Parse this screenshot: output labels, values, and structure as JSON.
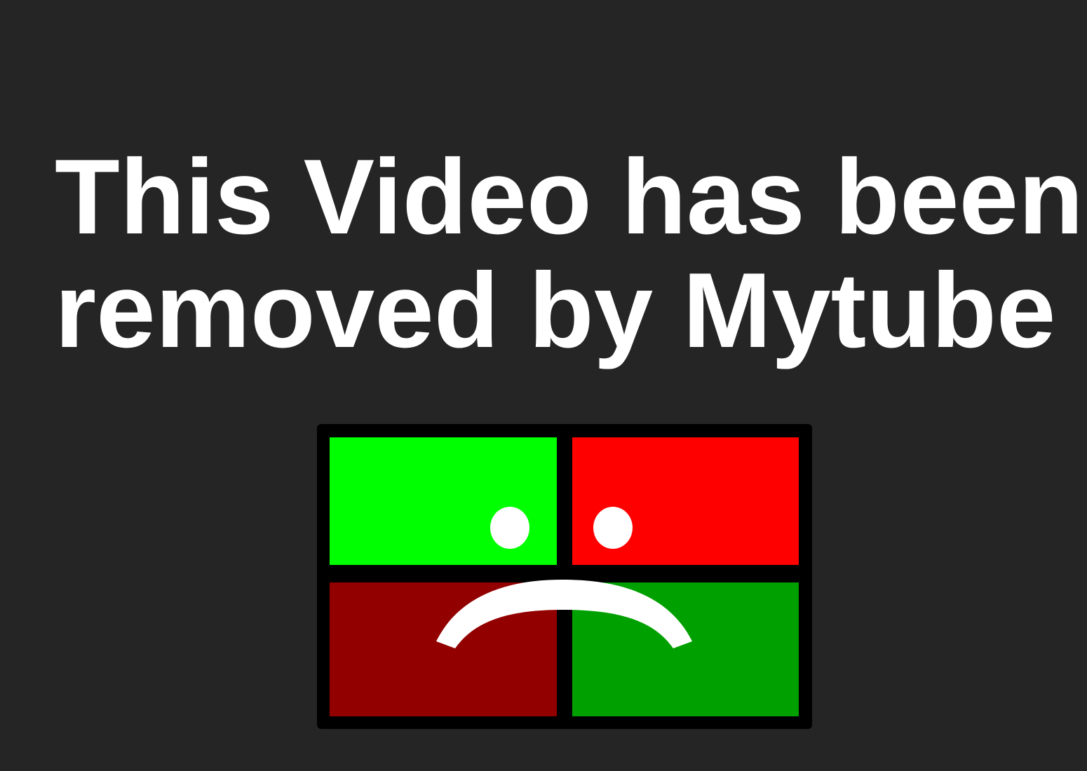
{
  "message": {
    "line1": "This Video has been",
    "line2": "removed by Mytube"
  },
  "logo": {
    "name": "mytube-sad-face-logo",
    "colors": {
      "frame": "#000000",
      "top_left": "#00ff00",
      "top_right": "#ff0000",
      "bottom_left": "#930000",
      "bottom_right": "#00a000",
      "face": "#ffffff"
    }
  },
  "colors": {
    "background": "#252525",
    "text": "#ffffff"
  }
}
